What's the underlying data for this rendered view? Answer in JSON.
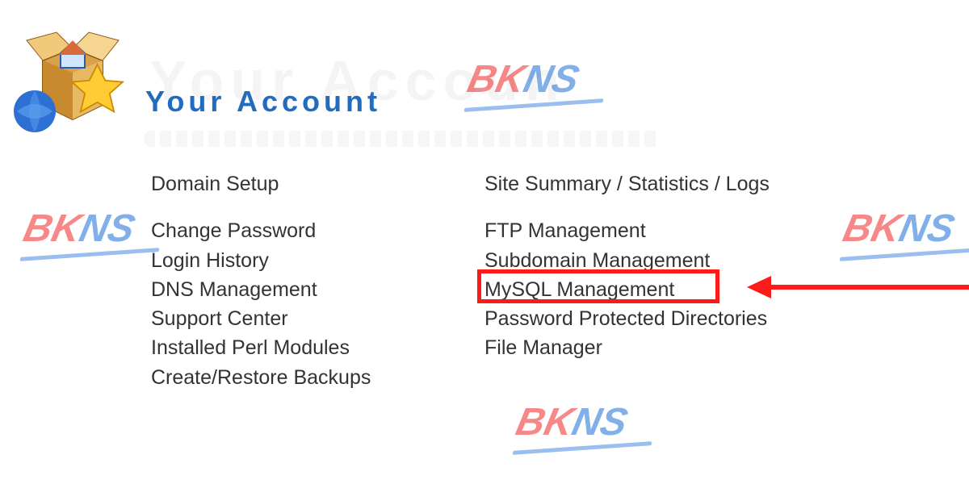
{
  "header": {
    "title": "Your Account",
    "ghost": "Your Accoun"
  },
  "columns": {
    "left": [
      {
        "label": "Domain Setup"
      },
      {
        "gap": true
      },
      {
        "label": "Change Password"
      },
      {
        "label": "Login History"
      },
      {
        "label": "DNS Management"
      },
      {
        "label": "Support Center"
      },
      {
        "label": "Installed Perl Modules"
      },
      {
        "label": "Create/Restore Backups"
      }
    ],
    "right": [
      {
        "label": "Site Summary / Statistics / Logs"
      },
      {
        "gap": true
      },
      {
        "label": "FTP Management"
      },
      {
        "label": "Subdomain Management"
      },
      {
        "label": "MySQL Management",
        "highlight": true
      },
      {
        "label": "Password Protected Directories"
      },
      {
        "label": "File Manager"
      }
    ]
  },
  "watermark": {
    "text_b": "BK",
    "text_k": "NS"
  }
}
